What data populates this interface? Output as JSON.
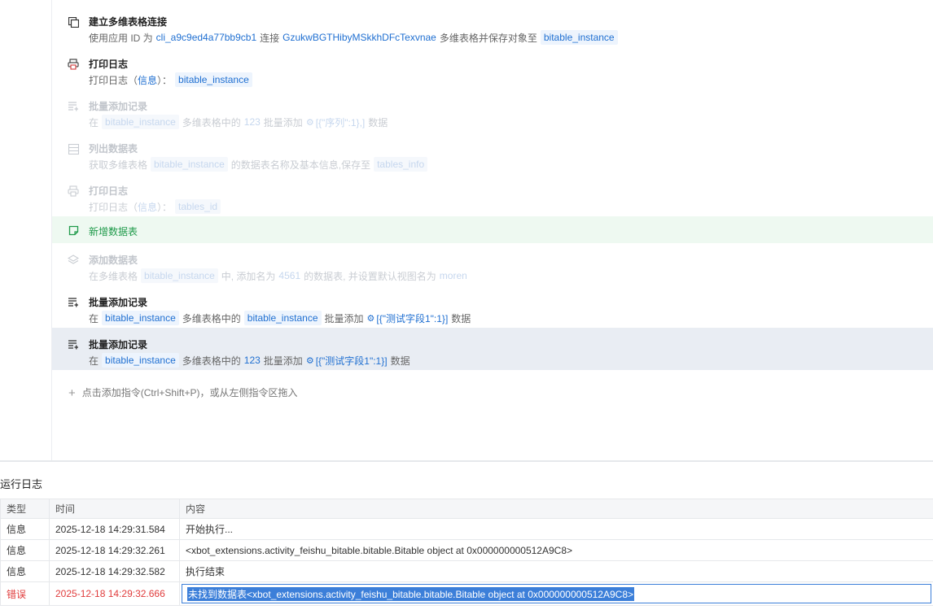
{
  "steps": [
    {
      "icon": "link-table-icon",
      "title": "建立多维表格连接",
      "desc": {
        "t1": "使用应用 ID 为",
        "app_id": "cli_a9c9ed4a77bb9cb1",
        "t2": "连接",
        "token": "GzukwBGTHibyMSkkhDFcTexvnae",
        "t3": "多维表格并保存对象至",
        "chip": "bitable_instance"
      }
    },
    {
      "icon": "printer-icon",
      "title": "打印日志",
      "desc": {
        "t1": "打印日志（",
        "level": "信息",
        "t2": "）：",
        "chip": "bitable_instance"
      }
    },
    {
      "icon": "batch-add-icon",
      "title": "批量添加记录",
      "desc": {
        "t1": "在",
        "chip": "bitable_instance",
        "t2": "多维表格中的",
        "table": "123",
        "t3": "批量添加",
        "records": "[{\"序列\":1},]",
        "t4": "数据"
      }
    },
    {
      "icon": "list-table-icon",
      "title": "列出数据表",
      "desc": {
        "t1": "获取多维表格",
        "chip": "bitable_instance",
        "t2": "的数据表名称及基本信息,保存至",
        "chip2": "tables_info"
      }
    },
    {
      "icon": "printer-icon",
      "title": "打印日志",
      "desc": {
        "t1": "打印日志（",
        "level": "信息",
        "t2": "）：",
        "chip": "tables_id"
      }
    },
    {
      "icon": "note-icon",
      "title": "新增数据表"
    },
    {
      "icon": "layers-icon",
      "title": "添加数据表",
      "desc": {
        "t1": "在多维表格",
        "chip": "bitable_instance",
        "t2": "中, 添加名为",
        "name": "4561",
        "t3": "的数据表, 并设置默认视图名为",
        "view": "moren"
      }
    },
    {
      "icon": "batch-add-icon",
      "title": "批量添加记录",
      "desc": {
        "t1": "在",
        "chip": "bitable_instance",
        "t2": "多维表格中的",
        "chip2": "bitable_instance",
        "t3": "批量添加",
        "records": "[{\"测试字段1\":1}]",
        "t4": "数据"
      }
    },
    {
      "icon": "batch-add-icon",
      "title": "批量添加记录",
      "desc": {
        "t1": "在",
        "chip": "bitable_instance",
        "t2": "多维表格中的",
        "table": "123",
        "t3": "批量添加",
        "records": "[{\"测试字段1\":1}]",
        "t4": "数据"
      }
    }
  ],
  "add_command": "点击添加指令(Ctrl+Shift+P)，或从左侧指令区拖入",
  "log": {
    "title": "运行日志",
    "headers": [
      "类型",
      "时间",
      "内容"
    ],
    "rows": [
      {
        "type": "信息",
        "time": "2025-12-18 14:29:31.584",
        "content": "开始执行..."
      },
      {
        "type": "信息",
        "time": "2025-12-18 14:29:32.261",
        "content": "<xbot_extensions.activity_feishu_bitable.bitable.Bitable object at 0x000000000512A9C8>"
      },
      {
        "type": "信息",
        "time": "2025-12-18 14:29:32.582",
        "content": "执行结束"
      },
      {
        "type": "错误",
        "time": "2025-12-18 14:29:32.666",
        "content": "未找到数据表<xbot_extensions.activity_feishu_bitable.bitable.Bitable object at 0x000000000512A9C8>"
      }
    ]
  },
  "colors": {
    "accent": "#1f6fd1",
    "green": "#1f9a4a",
    "error": "#e03c3c",
    "selection": "#3c7fd9"
  }
}
